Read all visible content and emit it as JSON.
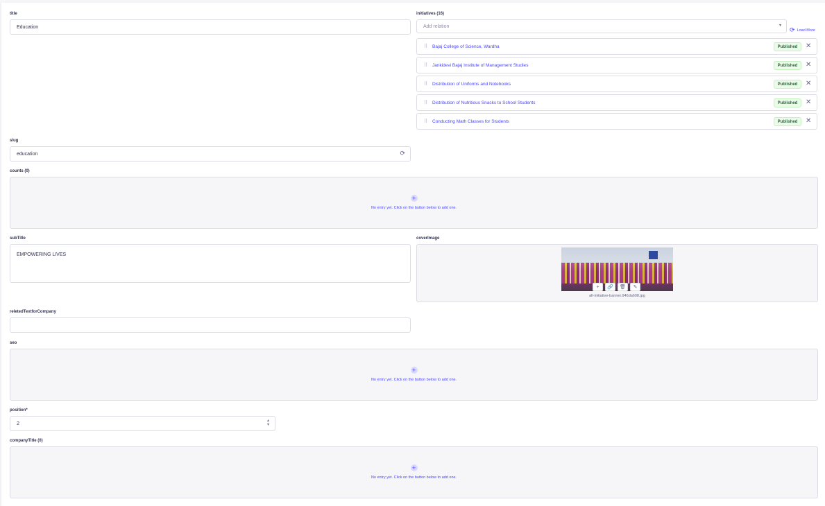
{
  "fields": {
    "title": {
      "label": "title",
      "value": "Education"
    },
    "initiatives": {
      "label": "initiatives (16)",
      "placeholder": "Add relation",
      "load_more": "Load More",
      "items": [
        {
          "name": "Bajaj College of Science, Wardha",
          "status": "Published"
        },
        {
          "name": "Jankidevi Bajaj Institute of Management Studies",
          "status": "Published"
        },
        {
          "name": "Distribution of Uniforms and Notebooks",
          "status": "Published"
        },
        {
          "name": "Distribution of Nutritious Snacks to School Students",
          "status": "Published"
        },
        {
          "name": "Conducting Math Classes for Students",
          "status": "Published"
        }
      ]
    },
    "slug": {
      "label": "slug",
      "value": "education"
    },
    "counts": {
      "label": "counts (0)",
      "empty": "No entry yet. Click on the button below to add one."
    },
    "subTitle": {
      "label": "subTitle",
      "value": "EMPOWERING LIVES"
    },
    "coverImage": {
      "label": "coverImage",
      "filename": "all-initiative-banner.946da698.jpg"
    },
    "reletedTextforCompany": {
      "label": "reletedTextforCompany",
      "value": ""
    },
    "seo": {
      "label": "seo",
      "empty": "No entry yet. Click on the button below to add one."
    },
    "position": {
      "label": "position*",
      "value": "2"
    },
    "companyTitle": {
      "label": "companyTitle (0)",
      "empty": "No entry yet. Click on the button below to add one."
    }
  },
  "colors": {
    "accent": "#4945ff",
    "success": "#2f6846",
    "border": "#dcdce4"
  }
}
